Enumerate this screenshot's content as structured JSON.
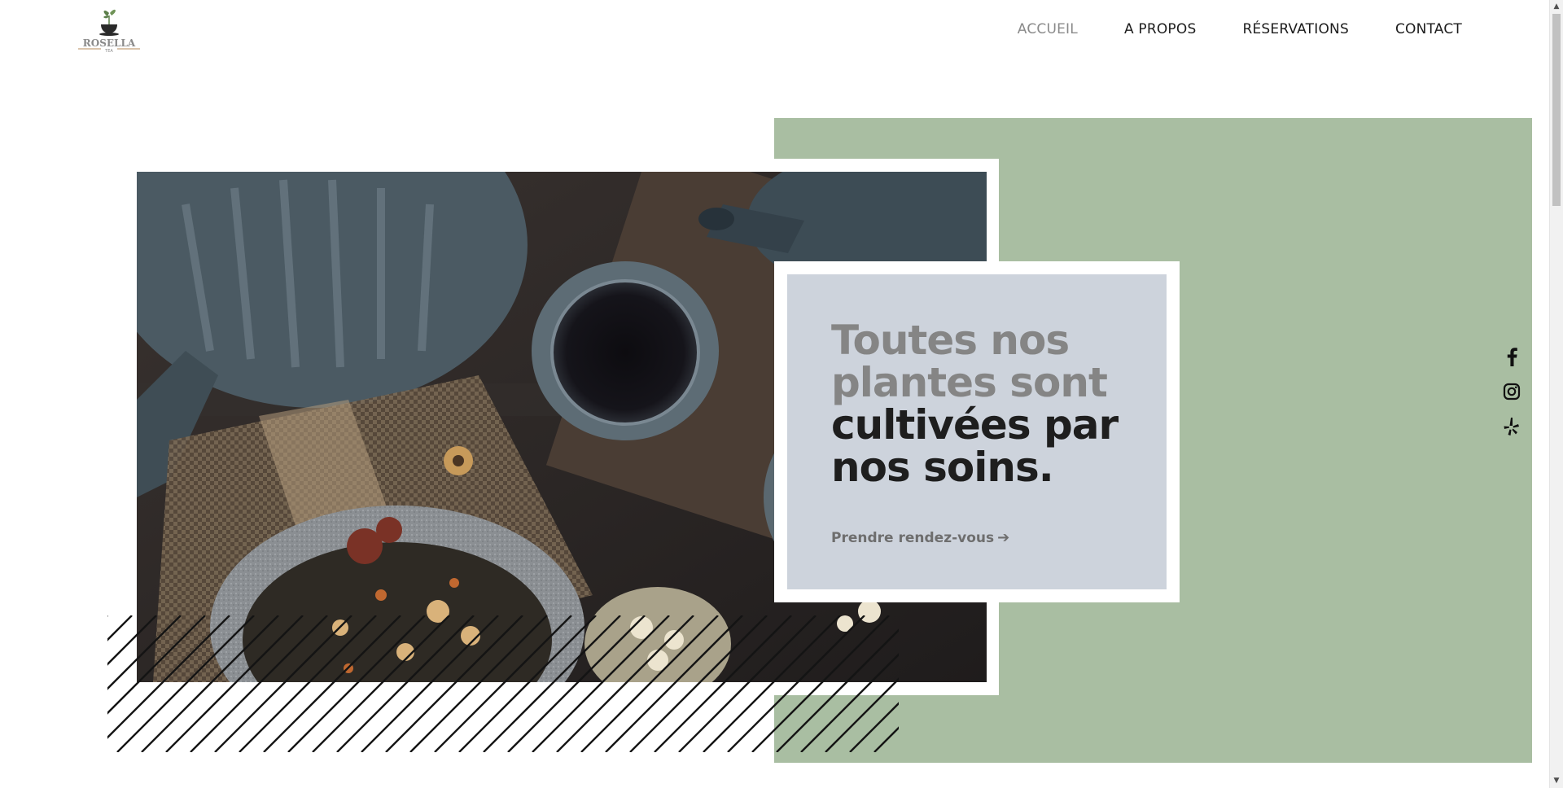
{
  "brand": {
    "name": "ROSELLA",
    "tagline": "TEA",
    "logo_icon": "teacup-leaf-icon"
  },
  "nav": {
    "items": [
      {
        "label": "ACCUEIL",
        "active": true
      },
      {
        "label": "A PROPOS",
        "active": false
      },
      {
        "label": "RÉSERVATIONS",
        "active": false
      },
      {
        "label": "CONTACT",
        "active": false
      }
    ]
  },
  "hero": {
    "headline_muted": "Toutes nos plantes sont",
    "headline_dark": "cultivées par nos soins.",
    "cta_label": "Prendre rendez-vous",
    "cta_icon": "arrow-right-icon",
    "image_description_icon": "tea-set-photo"
  },
  "social": [
    {
      "name": "facebook-icon"
    },
    {
      "name": "instagram-icon"
    },
    {
      "name": "yelp-icon"
    }
  ],
  "colors": {
    "green_panel": "#a9bea2",
    "card_bg": "#cdd3dc",
    "headline_muted": "#858585",
    "headline_dark": "#1e1e1e",
    "nav_active": "#8a8a8a"
  }
}
